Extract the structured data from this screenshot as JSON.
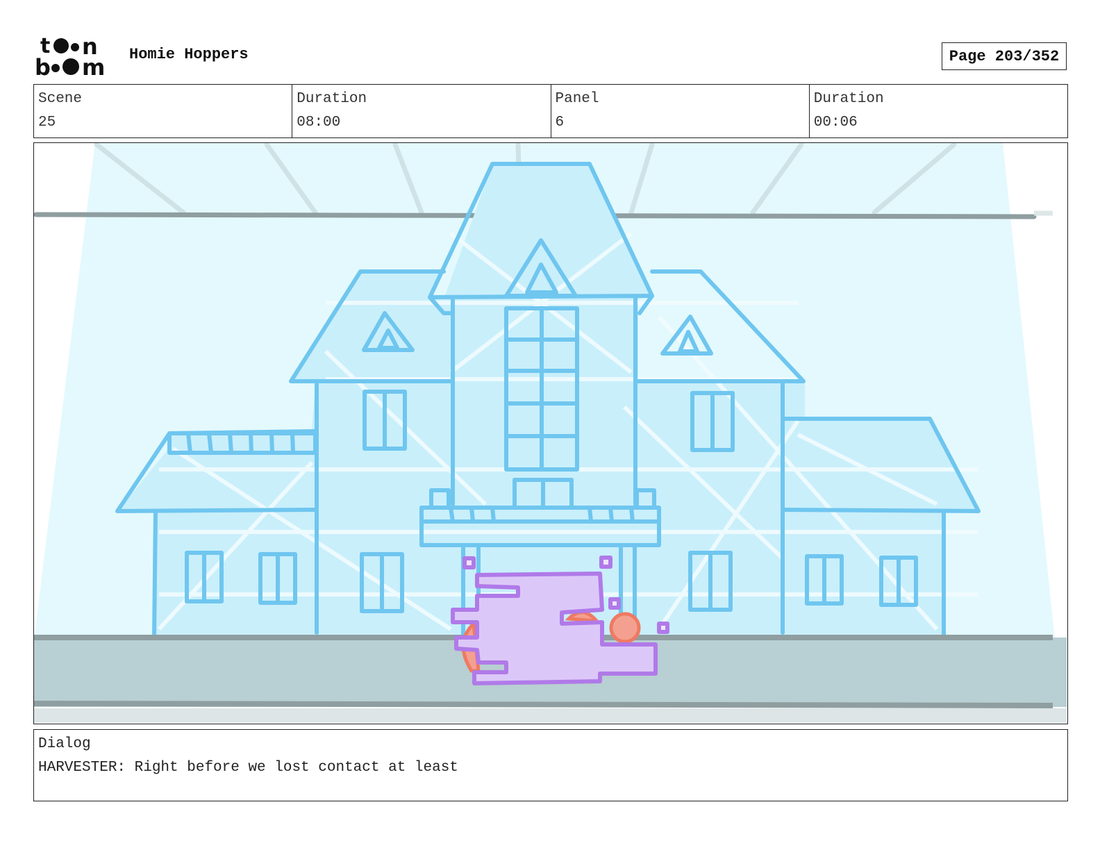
{
  "header": {
    "logo_text": "toon boom",
    "project_title": "Homie Hoppers",
    "page_label": "Page 203/352"
  },
  "info": {
    "scene_label": "Scene",
    "scene_value": "25",
    "scene_duration_label": "Duration",
    "scene_duration_value": "08:00",
    "panel_label": "Panel",
    "panel_value": "6",
    "panel_duration_label": "Duration",
    "panel_duration_value": "00:06"
  },
  "dialog": {
    "label": "Dialog",
    "text": "HARVESTER: Right before we lost contact at least"
  },
  "colors": {
    "sketch_blue": "#6fc6ef",
    "sky": "#e3f9fd",
    "ground": "#b8cfd3",
    "ship_fill": "#dcc8f8",
    "ship_stroke": "#b07ae8",
    "flame": "#f08870"
  }
}
